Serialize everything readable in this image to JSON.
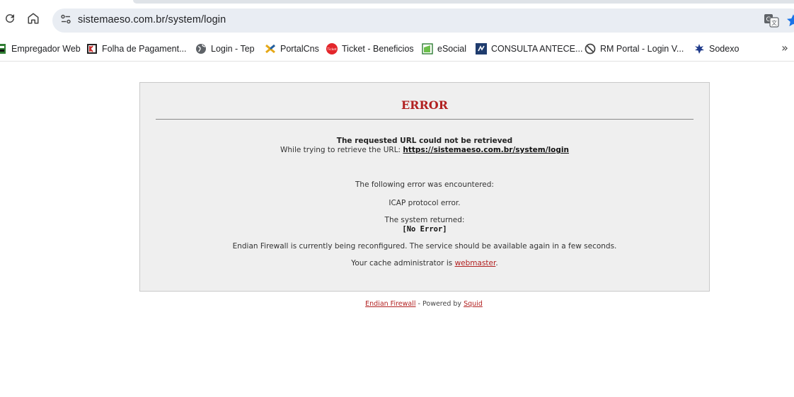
{
  "browser": {
    "url": "sistemaeso.com.br/system/login",
    "icons": [
      "reload-icon",
      "home-icon",
      "site-info-icon",
      "translate-icon",
      "bookmark-star-icon"
    ]
  },
  "bookmarks": [
    {
      "label": "Empregador Web",
      "icon": "empregador-web-icon"
    },
    {
      "label": "Folha de Pagament...",
      "icon": "folha-pagamento-icon"
    },
    {
      "label": "Login - Tep",
      "icon": "globe-icon"
    },
    {
      "label": "PortalCns",
      "icon": "portalcns-icon"
    },
    {
      "label": "Ticket - Beneficios",
      "icon": "ticket-icon",
      "icon_text": "Ticket"
    },
    {
      "label": "eSocial",
      "icon": "esocial-icon"
    },
    {
      "label": "CONSULTA ANTECE...",
      "icon": "consulta-icon"
    },
    {
      "label": "RM Portal - Login V...",
      "icon": "rm-portal-icon"
    },
    {
      "label": "Sodexo",
      "icon": "sodexo-icon"
    }
  ],
  "error_page": {
    "title": "ERROR",
    "heading": "The requested URL could not be retrieved",
    "retrieve_prefix": "While trying to retrieve the URL:",
    "requested_url": "https://sistemaeso.com.br/system/login",
    "encountered": "The following error was encountered:",
    "error_message": "ICAP protocol error.",
    "system_returned": "The system returned:",
    "system_error": "[No Error]",
    "reconfig_notice": "Endian Firewall is currently being reconfigured. The service should be available again in a few seconds.",
    "admin_prefix": "Your cache administrator is",
    "admin_link": "webmaster",
    "admin_suffix": ".",
    "accent_color": "#b22121"
  },
  "footer": {
    "product_link": "Endian Firewall",
    "powered_text": "- Powered by",
    "squid_link": "Squid"
  }
}
